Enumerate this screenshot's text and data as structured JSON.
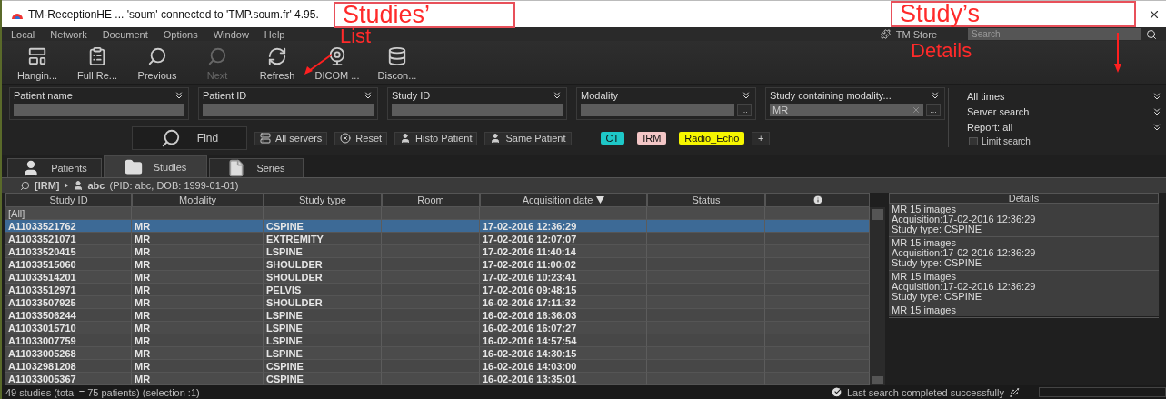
{
  "window": {
    "title": "TM-ReceptionHE ... 'soum' connected to 'TMP.soum.fr' 4.95."
  },
  "menu": [
    "Local",
    "Network",
    "Document",
    "Options",
    "Window",
    "Help"
  ],
  "menu_right": {
    "store": "TM Store",
    "search": {
      "placeholder": "Search"
    }
  },
  "toolbar": [
    {
      "label": "Hangin...",
      "kind": "hanging",
      "disabled": false
    },
    {
      "label": "Full Re...",
      "kind": "report",
      "disabled": false
    },
    {
      "label": "Previous",
      "kind": "previous",
      "disabled": false
    },
    {
      "label": "Next",
      "kind": "next",
      "disabled": true
    },
    {
      "label": "Refresh",
      "kind": "refresh",
      "disabled": false
    },
    {
      "label": "DICOM ...",
      "kind": "dicom",
      "disabled": false
    },
    {
      "label": "Discon...",
      "kind": "disconnect",
      "disabled": false
    }
  ],
  "filters": [
    {
      "label": "Patient name",
      "kind": "text"
    },
    {
      "label": "Patient ID",
      "kind": "text"
    },
    {
      "label": "Study ID",
      "kind": "text"
    },
    {
      "label": "Modality",
      "kind": "picker",
      "more": "..."
    },
    {
      "label": "Study containing modality...",
      "kind": "picker",
      "value": "MR",
      "more": "..."
    }
  ],
  "filter_options": [
    "All times",
    "Server search",
    "Report: all"
  ],
  "limit_search": {
    "label": "Limit search",
    "checked": false
  },
  "find": "Find",
  "actions": [
    {
      "label": "All servers",
      "kind": "servers"
    },
    {
      "label": "Reset",
      "kind": "reset"
    },
    {
      "label": "Histo Patient",
      "kind": "patient"
    },
    {
      "label": "Same Patient",
      "kind": "patient"
    }
  ],
  "tags": [
    {
      "label": "CT",
      "color": "#1ec8c8"
    },
    {
      "label": "IRM",
      "color": "#f3c6c6"
    },
    {
      "label": "Radio_Echo",
      "color": "#f6f600"
    }
  ],
  "add_tag": "+",
  "tabs": [
    {
      "label": "Patients",
      "kind": "person",
      "selected": false
    },
    {
      "label": "Studies",
      "kind": "folder",
      "selected": true
    },
    {
      "label": "Series",
      "kind": "file",
      "selected": false
    }
  ],
  "breadcrumb": {
    "filter": "[IRM]",
    "patient": "abc",
    "info": "(PID: abc, DOB: 1999-01-01)"
  },
  "table": {
    "columns": [
      {
        "label": "Study ID",
        "kind": "text",
        "sorted": false
      },
      {
        "label": "Modality",
        "kind": "text",
        "sorted": false
      },
      {
        "label": "Study type",
        "kind": "text",
        "sorted": false
      },
      {
        "label": "Room",
        "kind": "text",
        "sorted": false
      },
      {
        "label": "Acquisition date",
        "kind": "text",
        "sorted": true
      },
      {
        "label": "Status",
        "kind": "text",
        "sorted": false
      },
      {
        "kind": "info",
        "sorted": false
      }
    ],
    "filter_row": "[All]",
    "rows": [
      {
        "study_id": "A11033521762",
        "modality": "MR",
        "study_type": "CSPINE",
        "acquisition_date": "17-02-2016 12:36:29",
        "selected": true
      },
      {
        "study_id": "A11033521071",
        "modality": "MR",
        "study_type": "EXTREMITY",
        "acquisition_date": "17-02-2016 12:07:07",
        "selected": false
      },
      {
        "study_id": "A11033520415",
        "modality": "MR",
        "study_type": "LSPINE",
        "acquisition_date": "17-02-2016 11:40:14",
        "selected": false
      },
      {
        "study_id": "A11033515060",
        "modality": "MR",
        "study_type": "SHOULDER",
        "acquisition_date": "17-02-2016 11:00:02",
        "selected": false
      },
      {
        "study_id": "A11033514201",
        "modality": "MR",
        "study_type": "SHOULDER",
        "acquisition_date": "17-02-2016 10:23:41",
        "selected": false
      },
      {
        "study_id": "A11033512971",
        "modality": "MR",
        "study_type": "PELVIS",
        "acquisition_date": "17-02-2016 09:48:15",
        "selected": false
      },
      {
        "study_id": "A11033507925",
        "modality": "MR",
        "study_type": "SHOULDER",
        "acquisition_date": "16-02-2016 17:11:32",
        "selected": false
      },
      {
        "study_id": "A11033506244",
        "modality": "MR",
        "study_type": "LSPINE",
        "acquisition_date": "16-02-2016 16:36:03",
        "selected": false
      },
      {
        "study_id": "A11033015710",
        "modality": "MR",
        "study_type": "LSPINE",
        "acquisition_date": "16-02-2016 16:07:27",
        "selected": false
      },
      {
        "study_id": "A11033007759",
        "modality": "MR",
        "study_type": "LSPINE",
        "acquisition_date": "16-02-2016 14:57:54",
        "selected": false
      },
      {
        "study_id": "A11033005268",
        "modality": "MR",
        "study_type": "LSPINE",
        "acquisition_date": "16-02-2016 14:30:15",
        "selected": false
      },
      {
        "study_id": "A11032981208",
        "modality": "MR",
        "study_type": "CSPINE",
        "acquisition_date": "16-02-2016 14:03:00",
        "selected": false
      },
      {
        "study_id": "A11033005367",
        "modality": "MR",
        "study_type": "CSPINE",
        "acquisition_date": "16-02-2016 13:35:01",
        "selected": false
      }
    ]
  },
  "details": {
    "title": "Details",
    "entries": [
      {
        "lines": [
          "MR 15 images",
          "Acquisition:17-02-2016 12:36:29",
          "Study type: CSPINE"
        ]
      },
      {
        "lines": [
          "MR 15 images",
          "Acquisition:17-02-2016 12:36:29",
          "Study type: CSPINE"
        ]
      },
      {
        "lines": [
          "MR 15 images",
          "Acquisition:17-02-2016 12:36:29",
          "Study type: CSPINE"
        ]
      },
      {
        "lines": [
          "MR 15 images"
        ]
      }
    ]
  },
  "status_bar": {
    "summary": "49 studies (total = 75 patients) (selection :1)",
    "message": "Last search completed successfully"
  },
  "annotations": [
    {
      "title": "Studies’",
      "caption": "List"
    },
    {
      "title": "Study’s",
      "caption": "Details"
    }
  ]
}
